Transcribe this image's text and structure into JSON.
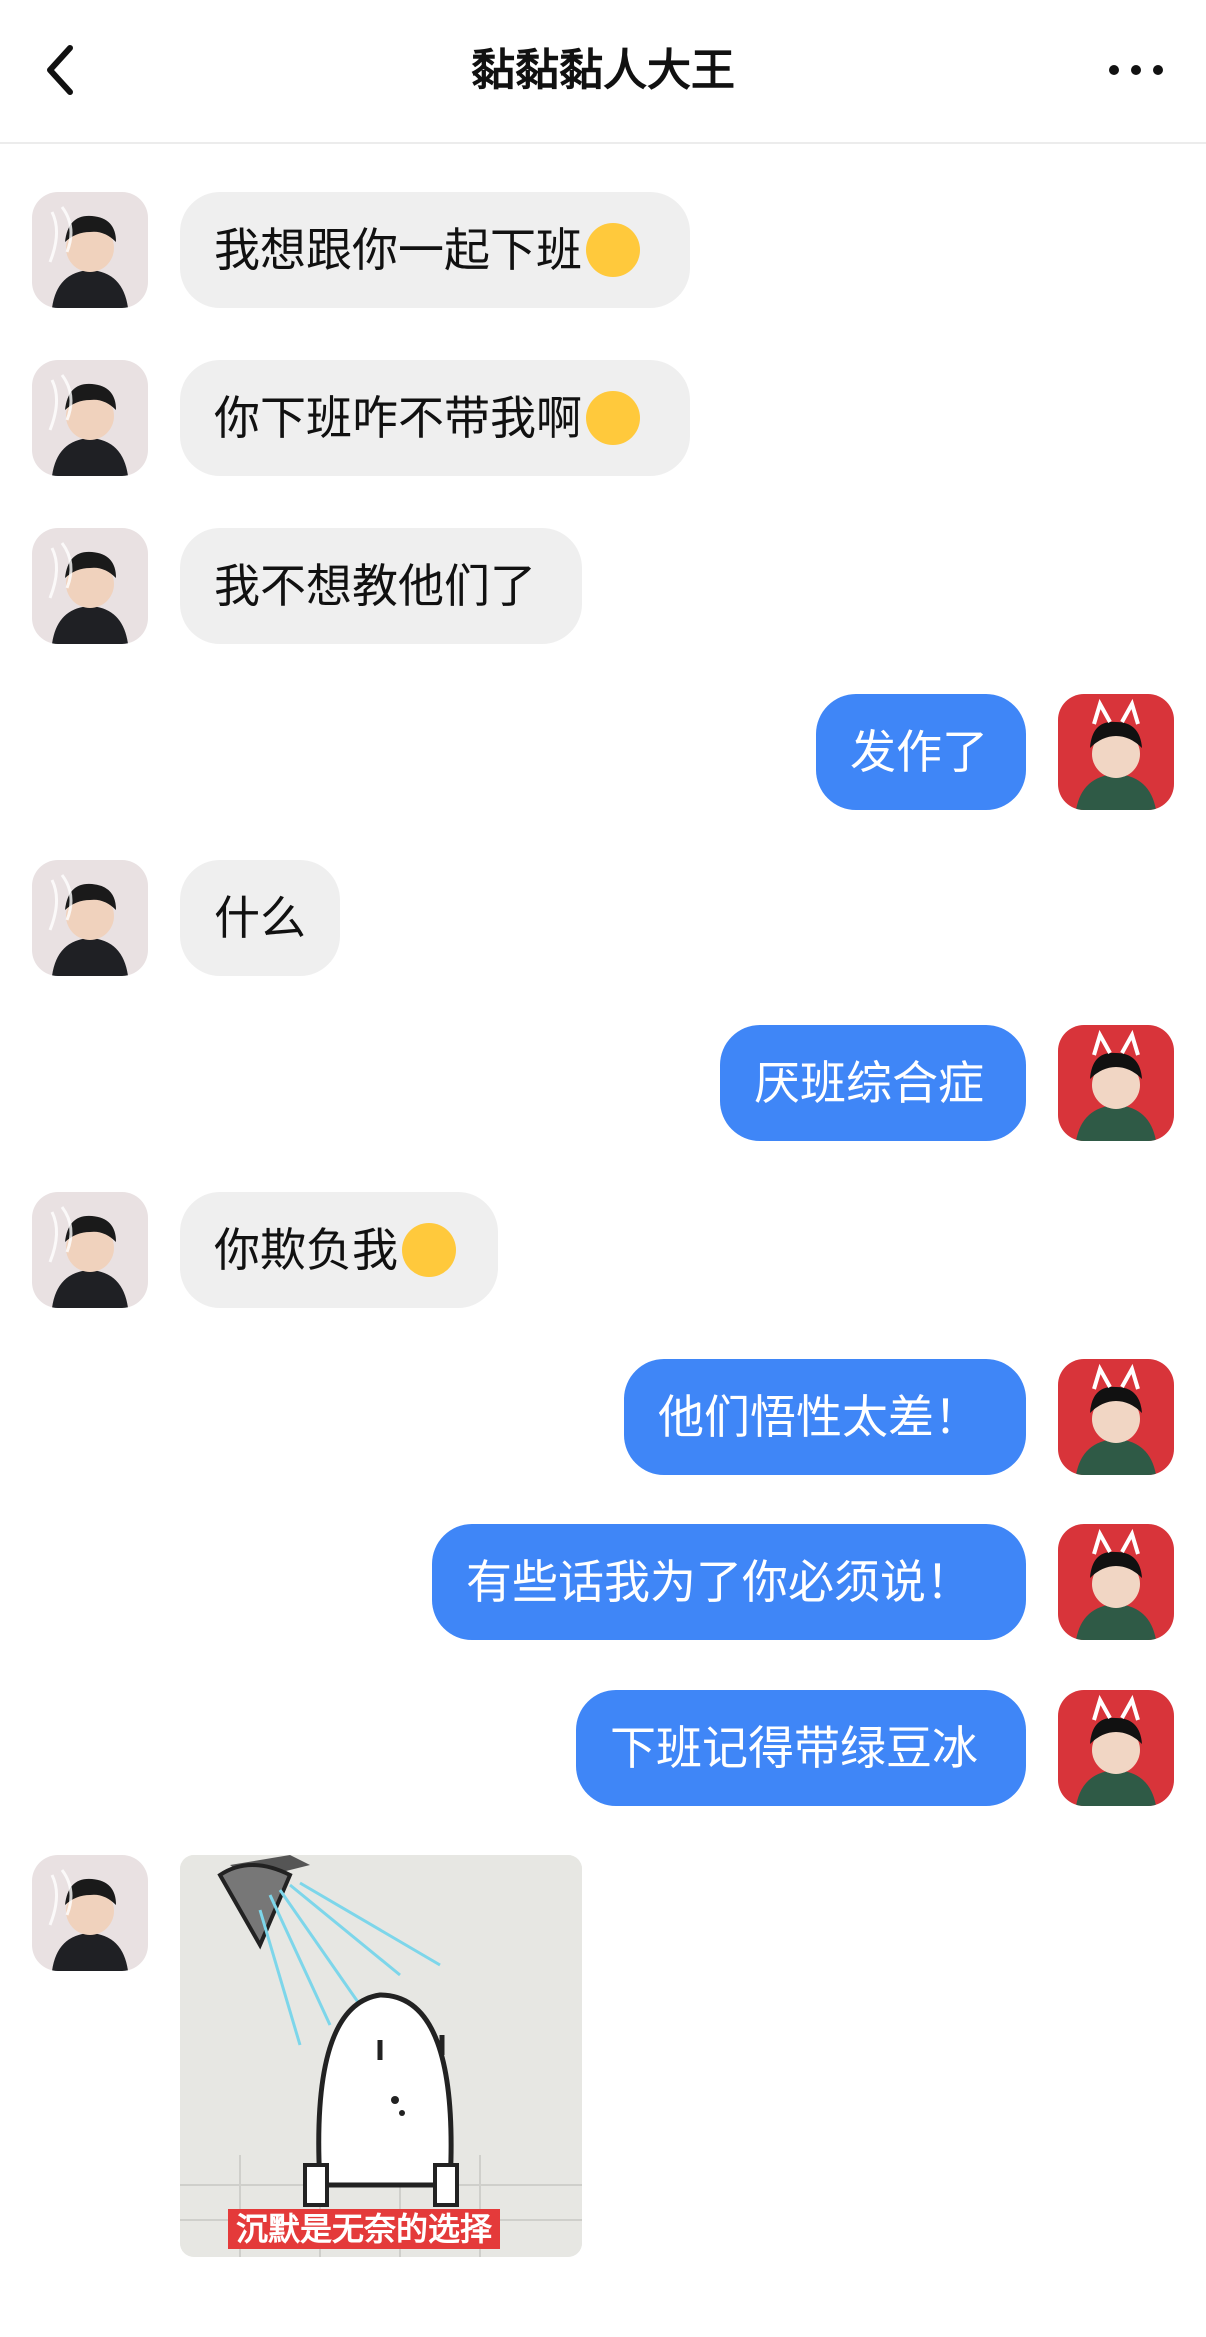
{
  "header": {
    "title": "黏黏黏人大王",
    "back_icon": "chevron-left-icon",
    "more_icon": "more-dots-icon"
  },
  "messages": [
    {
      "side": "left",
      "text": "我想跟你一起下班",
      "emoji": "crying-emoji"
    },
    {
      "side": "left",
      "text": "你下班咋不带我啊",
      "emoji": "crying-emoji"
    },
    {
      "side": "left",
      "text": "我不想教他们了"
    },
    {
      "side": "right",
      "text": "发作了"
    },
    {
      "side": "left",
      "text": "什么"
    },
    {
      "side": "right",
      "text": "厌班综合症"
    },
    {
      "side": "left",
      "text": "你欺负我",
      "emoji": "crying-emoji"
    },
    {
      "side": "right",
      "text": "他们悟性太差！"
    },
    {
      "side": "right",
      "text": "有些话我为了你必须说！"
    },
    {
      "side": "right",
      "text": "下班记得带绿豆冰"
    },
    {
      "side": "left",
      "type": "sticker",
      "caption": "沉默是无奈的选择"
    }
  ],
  "colors": {
    "outgoing_bubble": "#3f86f7",
    "incoming_bubble": "#efefef",
    "accent_avatar": "#d8343a"
  }
}
